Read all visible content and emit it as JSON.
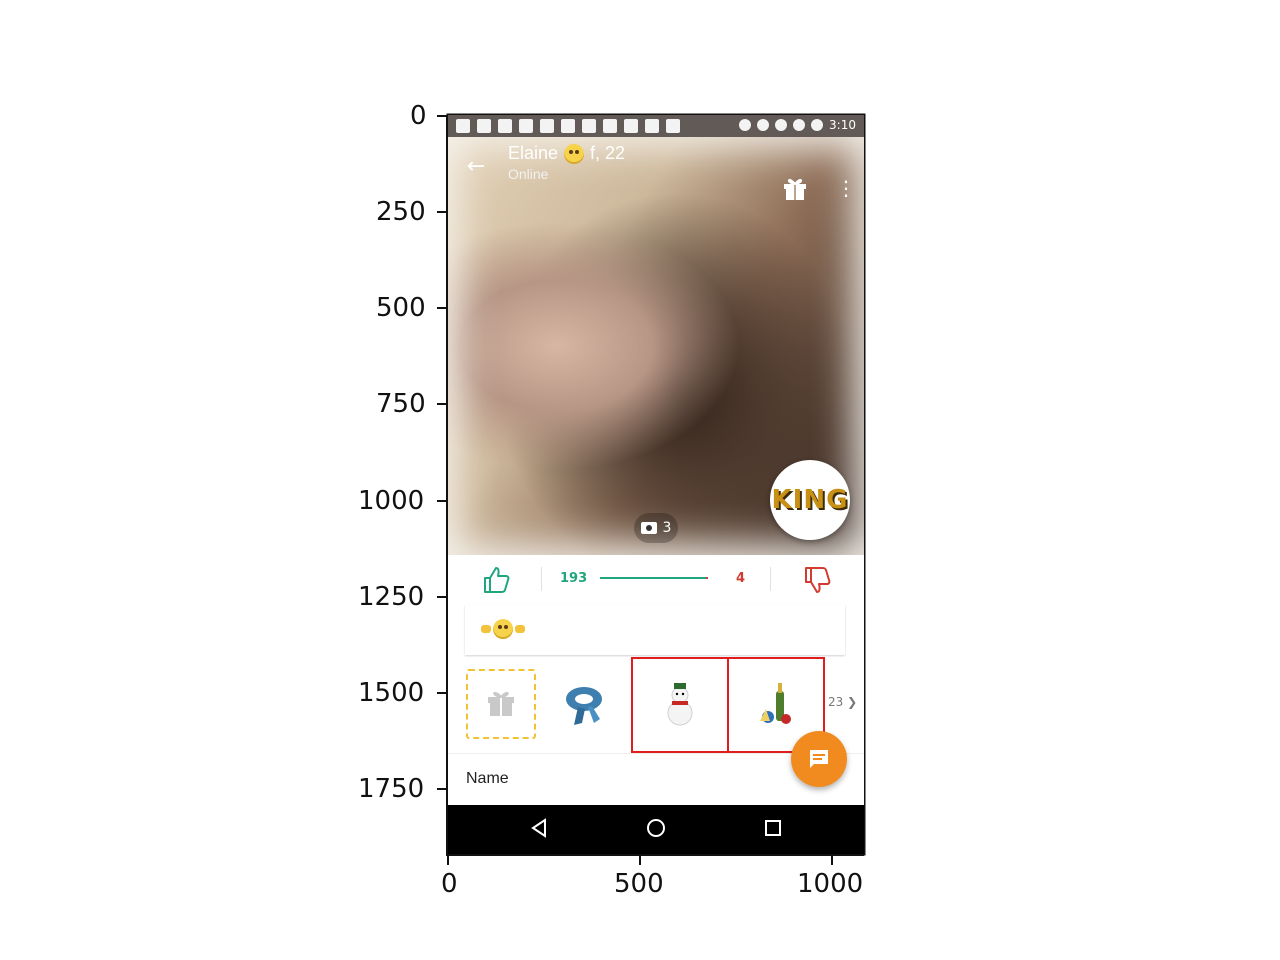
{
  "axes": {
    "y_ticks": [
      "0",
      "250",
      "500",
      "750",
      "1000",
      "1250",
      "1500",
      "1750"
    ],
    "x_ticks": [
      "0",
      "500",
      "1000"
    ]
  },
  "status_bar": {
    "time": "3:10",
    "icons": [
      "message-icon",
      "facebook-icon",
      "facebook-icon",
      "facebook-icon",
      "facebook-icon",
      "puzzle-icon",
      "person-icon",
      "eye-icon",
      "eye-icon",
      "square-icon",
      "eye-icon",
      "bluetooth-icon",
      "do-not-disturb-icon",
      "wifi-icon",
      "no-sim-icon",
      "battery-icon"
    ]
  },
  "header": {
    "name": "Elaine",
    "age_text": "f, 22",
    "status": "Online"
  },
  "photo": {
    "count": "3",
    "badge_text": "KING"
  },
  "votes": {
    "likes": "193",
    "dislikes": "4",
    "like_ratio": 0.98
  },
  "gifts": {
    "more_count": "23"
  },
  "profile": {
    "name_label": "Name"
  },
  "colors": {
    "accent_green": "#1fa67f",
    "accent_red": "#d23b2f",
    "fab_orange": "#f18b1f",
    "highlight_red": "#e11d1d",
    "gift_dash": "#f1c232"
  }
}
